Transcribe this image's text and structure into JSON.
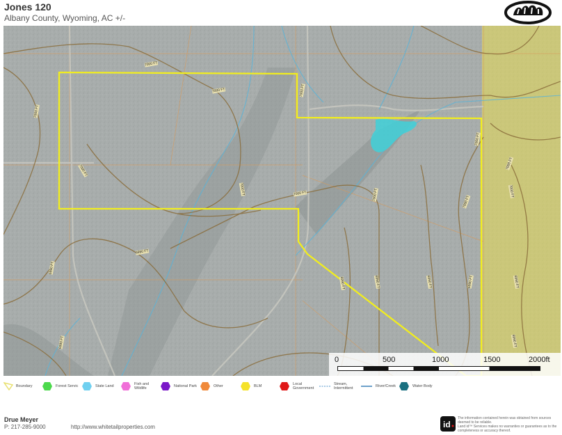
{
  "header": {
    "title": "Jones 120",
    "subtitle": "Albany County, Wyoming,  AC +/-"
  },
  "map": {
    "contour_labels": [
      "7000 FT",
      "7000 FT",
      "7000 FT",
      "7000 FT",
      "7000 FT",
      "7000 FT",
      "7000 FT",
      "7000 FT",
      "7000 FT",
      "7000 FT",
      "7000 FT",
      "7000 FT",
      "6990 FT",
      "6990 FT",
      "6990 FT",
      "6990 FT",
      "6990 FT",
      "6990 FT",
      "6990 FT",
      "6990 FT",
      "6990 FT"
    ],
    "scale_bar": {
      "ticks": [
        "0",
        "500",
        "1000",
        "1500",
        "2000ft"
      ]
    },
    "colors": {
      "boundary": "#f2ee1d",
      "blm": "#e8dc52",
      "water_body": "#3fd0d8",
      "stream": "#5ab4d8",
      "contour": "#8a6d3b"
    }
  },
  "legend": [
    {
      "label": "Boundary",
      "icon": "boundary-icon",
      "color": "#e8e070"
    },
    {
      "label": "Forest Servic",
      "icon": "forest-service-icon",
      "color": "#4cd94c"
    },
    {
      "label": "State Land",
      "icon": "state-land-icon",
      "color": "#6fd0f0"
    },
    {
      "label": "Fish and\nWildlife",
      "icon": "fish-wildlife-icon",
      "color": "#f06fd8"
    },
    {
      "label": "National Park",
      "icon": "national-park-icon",
      "color": "#7a18c8"
    },
    {
      "label": "Other",
      "icon": "other-icon",
      "color": "#f08a3a"
    },
    {
      "label": "BLM",
      "icon": "blm-icon",
      "color": "#f5e22a"
    },
    {
      "label": "Local\nGovernment",
      "icon": "local-government-icon",
      "color": "#e01818"
    },
    {
      "label": "Stream,\nIntermittent",
      "icon": "stream-intermittent-icon",
      "color": "#4a90c8"
    },
    {
      "label": "River/Creek",
      "icon": "river-creek-icon",
      "color": "#3a80b8"
    },
    {
      "label": "Water Body",
      "icon": "water-body-icon",
      "color": "#1a7080"
    }
  ],
  "footer": {
    "name": "Drue Meyer",
    "phone": "P: 217-285-9000",
    "url": "http://www.whitetailproperties.com",
    "disclaimer": "The information contained herein was obtained from sources deemed to be reliable.\n Land id™ Services makes no warranties or guarantees as to the completeness or accuracy thereof."
  }
}
